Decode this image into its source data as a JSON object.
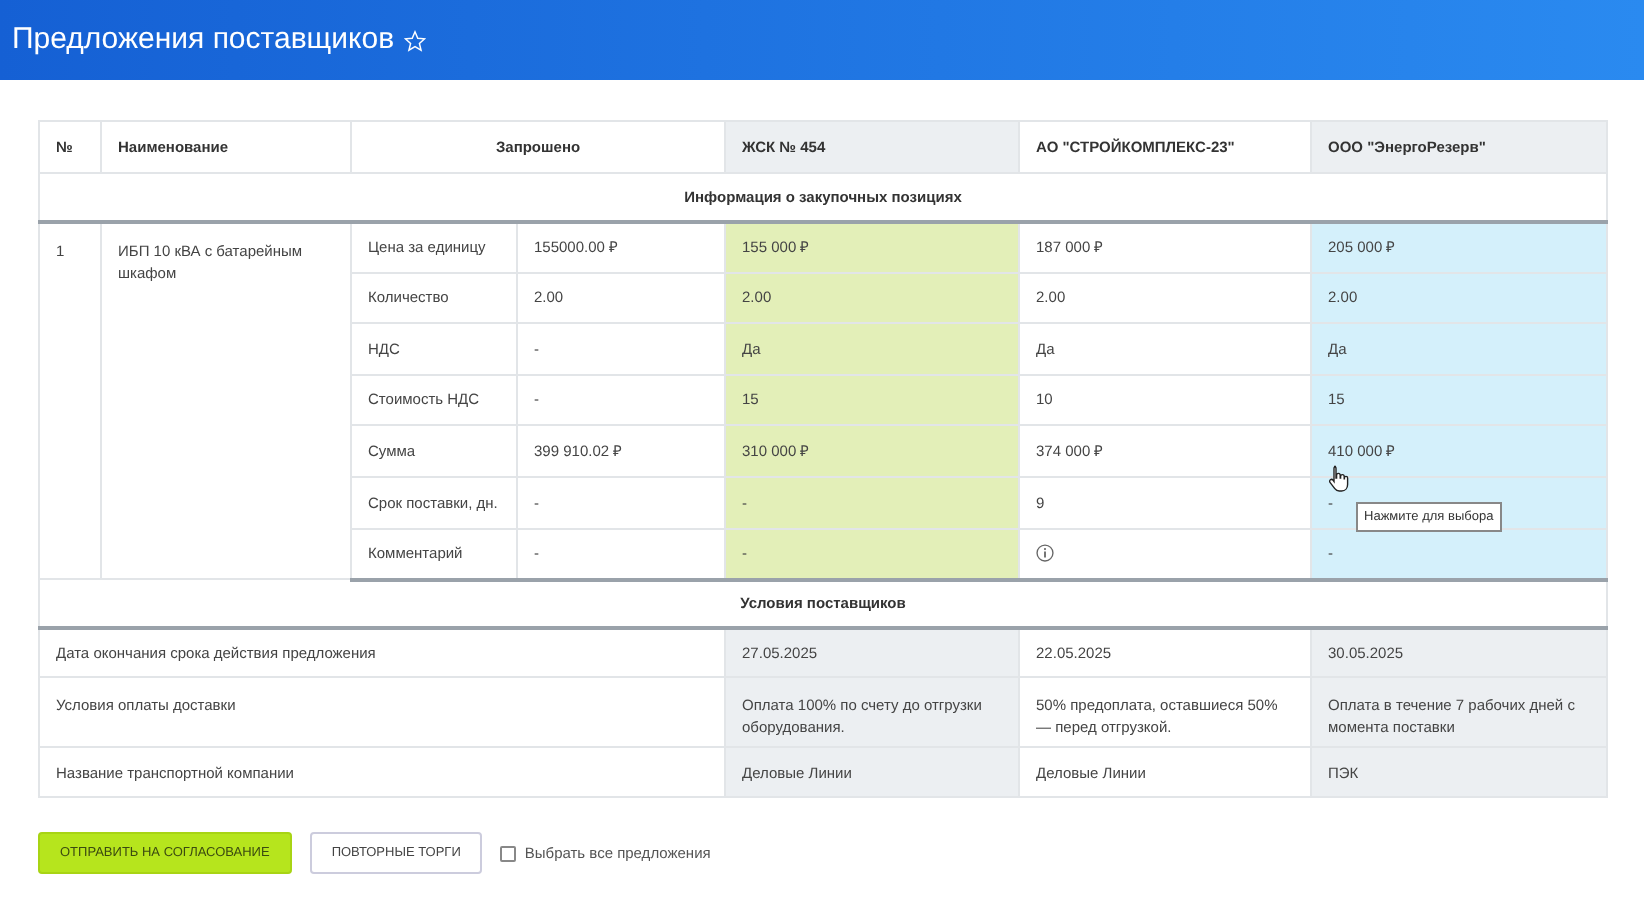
{
  "header": {
    "title": "Предложения поставщиков",
    "favorite": false
  },
  "table": {
    "columns": {
      "number": "№",
      "name": "Наименование",
      "requested": "Запрошено"
    },
    "suppliers": [
      {
        "name": "ЖСК № 454",
        "selected": true,
        "hovered": false
      },
      {
        "name": "АО \"СТРОЙКОМПЛЕКС-23\"",
        "selected": false,
        "hovered": false
      },
      {
        "name": "ООО \"ЭнергоРезерв\"",
        "selected": false,
        "hovered": true
      }
    ],
    "item_section": {
      "title": "Информация о закупочных позициях",
      "items": [
        {
          "number": "1",
          "name": "ИБП 10 кВА с батарейным шкафом",
          "params": [
            {
              "label": "Цена за единицу",
              "requested": "155000.00 ₽",
              "offers": [
                {
                  "kind": "text",
                  "text": "155 000 ₽"
                },
                {
                  "kind": "text",
                  "text": "187 000 ₽"
                },
                {
                  "kind": "text",
                  "text": "205 000 ₽"
                }
              ]
            },
            {
              "label": "Количество",
              "requested": "2.00",
              "offers": [
                {
                  "kind": "text",
                  "text": "2.00"
                },
                {
                  "kind": "text",
                  "text": "2.00"
                },
                {
                  "kind": "text",
                  "text": "2.00"
                }
              ]
            },
            {
              "label": "НДС",
              "requested": "-",
              "offers": [
                {
                  "kind": "text",
                  "text": "Да"
                },
                {
                  "kind": "text",
                  "text": "Да"
                },
                {
                  "kind": "text",
                  "text": "Да"
                }
              ]
            },
            {
              "label": "Стоимость НДС",
              "requested": "-",
              "offers": [
                {
                  "kind": "text",
                  "text": "15"
                },
                {
                  "kind": "text",
                  "text": "10"
                },
                {
                  "kind": "text",
                  "text": "15"
                }
              ]
            },
            {
              "label": "Сумма",
              "requested": "399 910.02 ₽",
              "offers": [
                {
                  "kind": "text",
                  "text": "310 000 ₽"
                },
                {
                  "kind": "text",
                  "text": "374 000 ₽"
                },
                {
                  "kind": "text",
                  "text": "410 000 ₽",
                  "pointer": true
                }
              ]
            },
            {
              "label": "Срок поставки, дн.",
              "requested": "-",
              "offers": [
                {
                  "kind": "text",
                  "text": "-"
                },
                {
                  "kind": "text",
                  "text": "9"
                },
                {
                  "kind": "text",
                  "text": "-",
                  "tooltip": "Нажмите для выбора"
                }
              ]
            },
            {
              "label": "Комментарий",
              "requested": "-",
              "offers": [
                {
                  "kind": "text",
                  "text": "-"
                },
                {
                  "kind": "info"
                },
                {
                  "kind": "text",
                  "text": "-"
                }
              ]
            }
          ]
        }
      ]
    },
    "terms_section": {
      "title": "Условия поставщиков",
      "rows": [
        {
          "label": "Дата окончания срока действия предложения",
          "offers": [
            "27.05.2025",
            "22.05.2025",
            "30.05.2025"
          ]
        },
        {
          "label": "Условия оплаты доставки",
          "offers": [
            "Оплата 100% по счету до отгрузки оборудования.",
            "50% предоплата, оставшиеся 50% — перед отгрузкой.",
            "Оплата в течение 7 рабочих дней с момента поставки"
          ]
        },
        {
          "label": "Название транспортной компании",
          "offers": [
            "Деловые Линии",
            "Деловые Линии",
            "ПЭК"
          ]
        }
      ]
    }
  },
  "footer": {
    "buttons": [
      {
        "label": "ОТПРАВИТЬ НА СОГЛАСОВАНИЕ",
        "kind": "primary"
      },
      {
        "label": "ПОВТОРНЫЕ ТОРГИ",
        "kind": "outline"
      }
    ],
    "checkbox": {
      "label": "Выбрать все предложения",
      "checked": false
    }
  }
}
